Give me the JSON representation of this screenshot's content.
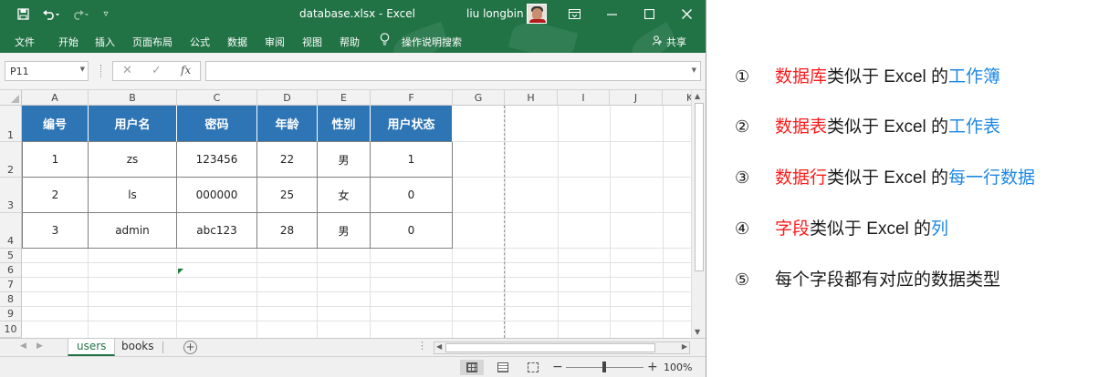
{
  "titlebar": {
    "document_title": "database.xlsx  -  Excel",
    "user_name": "liu longbin",
    "icons": [
      "save-icon",
      "undo-icon",
      "redo-icon",
      "customize-qat-icon",
      "ribbon-display-icon",
      "minimize-icon",
      "restore-icon",
      "close-icon"
    ]
  },
  "menu": {
    "items": [
      "文件",
      "开始",
      "插入",
      "页面布局",
      "公式",
      "数据",
      "审阅",
      "视图",
      "帮助"
    ],
    "tell_me": "操作说明搜索",
    "share": "共享"
  },
  "formula_bar": {
    "name_box": "P11",
    "cancel_glyph": "✕",
    "enter_glyph": "✓",
    "fx_glyph": "fx",
    "formula_value": ""
  },
  "grid": {
    "columns": [
      "A",
      "B",
      "C",
      "D",
      "E",
      "F",
      "G",
      "H",
      "I",
      "J",
      "K"
    ],
    "rows": [
      "1",
      "2",
      "3",
      "4",
      "5",
      "6",
      "7",
      "8",
      "9",
      "10"
    ],
    "headers": [
      "编号",
      "用户名",
      "密码",
      "年龄",
      "性别",
      "用户状态"
    ],
    "data": [
      [
        "1",
        "zs",
        "123456",
        "22",
        "男",
        "1"
      ],
      [
        "2",
        "ls",
        "000000",
        "25",
        "女",
        "0"
      ],
      [
        "3",
        "admin",
        "abc123",
        "28",
        "男",
        "0"
      ]
    ],
    "header_color": "#2e75b6"
  },
  "sheets": {
    "tabs": [
      "users",
      "books"
    ],
    "active": "users"
  },
  "status": {
    "zoom": "100%"
  },
  "notes": [
    {
      "num": "①",
      "red": "数据库",
      "mid": "类似于 Excel 的",
      "blue": "工作簿"
    },
    {
      "num": "②",
      "red": "数据表",
      "mid": "类似于 Excel 的",
      "blue": "工作表"
    },
    {
      "num": "③",
      "red": "数据行",
      "mid": "类似于 Excel 的",
      "blue": "每一行数据"
    },
    {
      "num": "④",
      "red": "字段",
      "mid": "类似于 Excel 的",
      "blue": "列"
    },
    {
      "num": "⑤",
      "red": "",
      "mid": "每个字段都有对应的数据类型",
      "blue": ""
    }
  ],
  "colors": {
    "excel_green": "#217346",
    "highlight_red": "#ff1a1a",
    "highlight_blue": "#1e88e5"
  }
}
